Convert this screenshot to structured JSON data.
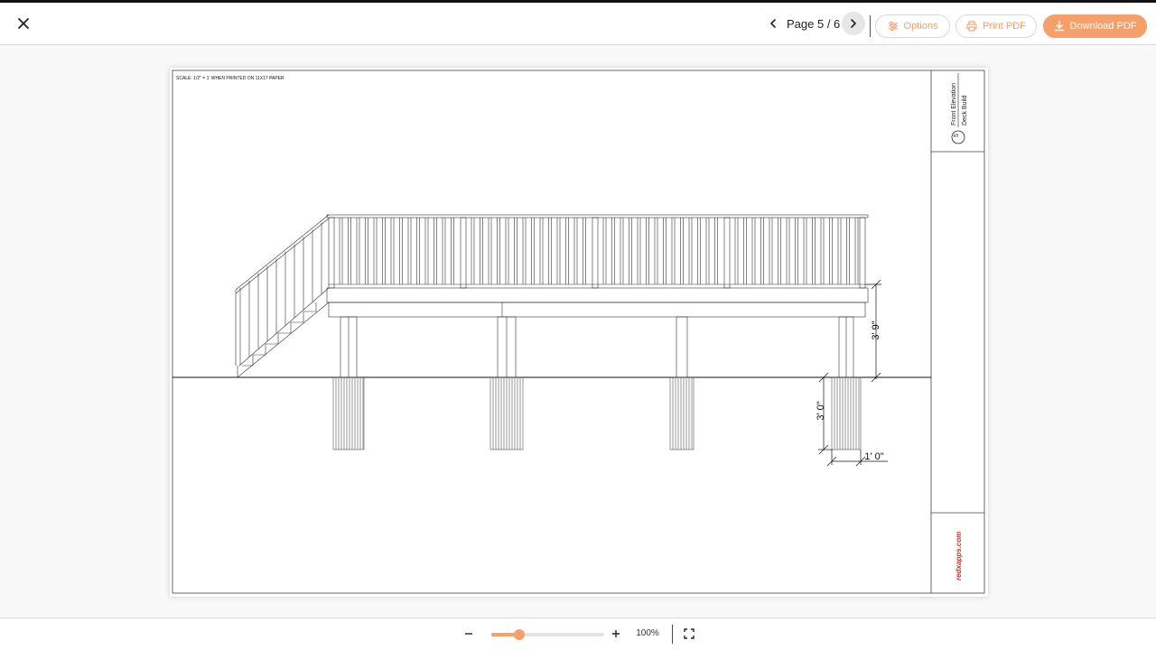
{
  "toolbar": {
    "page_label": "Page 5 / 6",
    "options_label": "Options",
    "print_label": "Print PDF",
    "download_label": "Download PDF",
    "accent_color": "#f5a06a"
  },
  "icons": {
    "close": "close-icon",
    "prev": "chevron-left-icon",
    "next": "chevron-right-icon",
    "options": "sliders-icon",
    "print": "printer-icon",
    "download": "download-icon",
    "zoom_out": "minus-icon",
    "zoom_in": "plus-icon",
    "fullscreen": "fullscreen-icon"
  },
  "drawing": {
    "scale_note": "SCALE: 1/2\" = 1' WHEN PRINTED ON 11X17 PAPER",
    "dim_height": "3' 9\"",
    "dim_footing_depth": "3' 0\"",
    "dim_footing_width": "1' 0\"",
    "sheet_number": "5",
    "sheet_title": "Front Elevation",
    "project_title": "Deck Build",
    "logo_text": "redxapps.com"
  },
  "zoom": {
    "label": "100%",
    "level": 0.25
  }
}
